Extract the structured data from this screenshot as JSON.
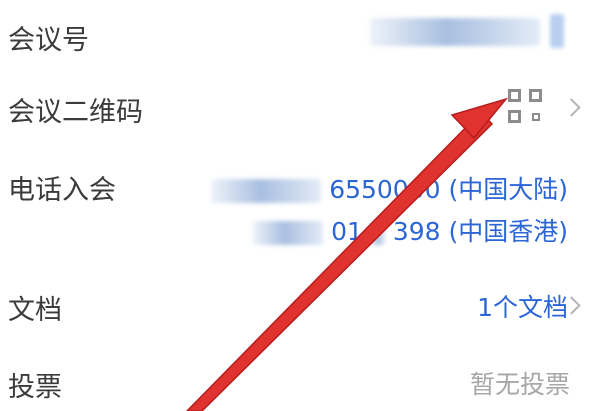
{
  "meeting_id": {
    "label": "会议号",
    "value": ""
  },
  "qr_code": {
    "label": "会议二维码"
  },
  "phone": {
    "label": "电话入会",
    "line1_visible": "6550000",
    "line1_region": "(中国大陆)",
    "line2_visible": "01",
    "line2_partial": "398",
    "line2_region": "(中国香港)"
  },
  "documents": {
    "label": "文档",
    "value": "1个文档"
  },
  "vote": {
    "label": "投票",
    "value": "暂无投票"
  },
  "colors": {
    "accent": "#2c66d6",
    "arrow": "#e0322f",
    "muted": "#a7a7a7"
  }
}
